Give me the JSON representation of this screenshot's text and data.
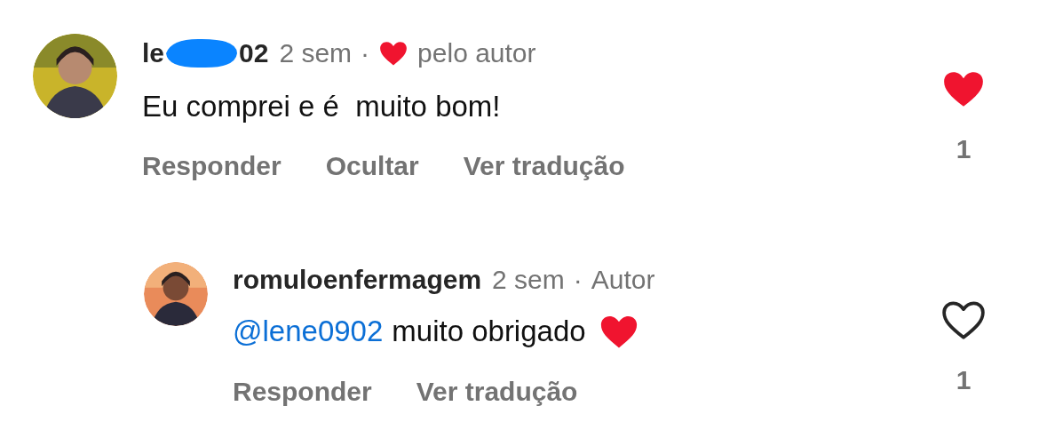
{
  "comments": [
    {
      "author": {
        "parts": [
          "le",
          "02"
        ],
        "redacted": true
      },
      "time": "2 sem",
      "separator": "·",
      "author_note": {
        "heart": true,
        "text": "pelo autor"
      },
      "text": "Eu comprei e é  muito bom!",
      "heart_emoji": false,
      "actions": [
        "Responder",
        "Ocultar",
        "Ver tradução"
      ],
      "liked": true,
      "like_count": "1",
      "reply": false
    },
    {
      "author": {
        "parts": [
          "romuloenfermagem"
        ],
        "redacted": false
      },
      "time": "2 sem",
      "separator": "·",
      "author_note": {
        "heart": false,
        "text": "Autor"
      },
      "mention": "@lene0902",
      "text": "muito obrigado",
      "heart_emoji": true,
      "actions": [
        "Responder",
        "Ver tradução"
      ],
      "liked": false,
      "like_count": "1",
      "reply": true
    }
  ]
}
